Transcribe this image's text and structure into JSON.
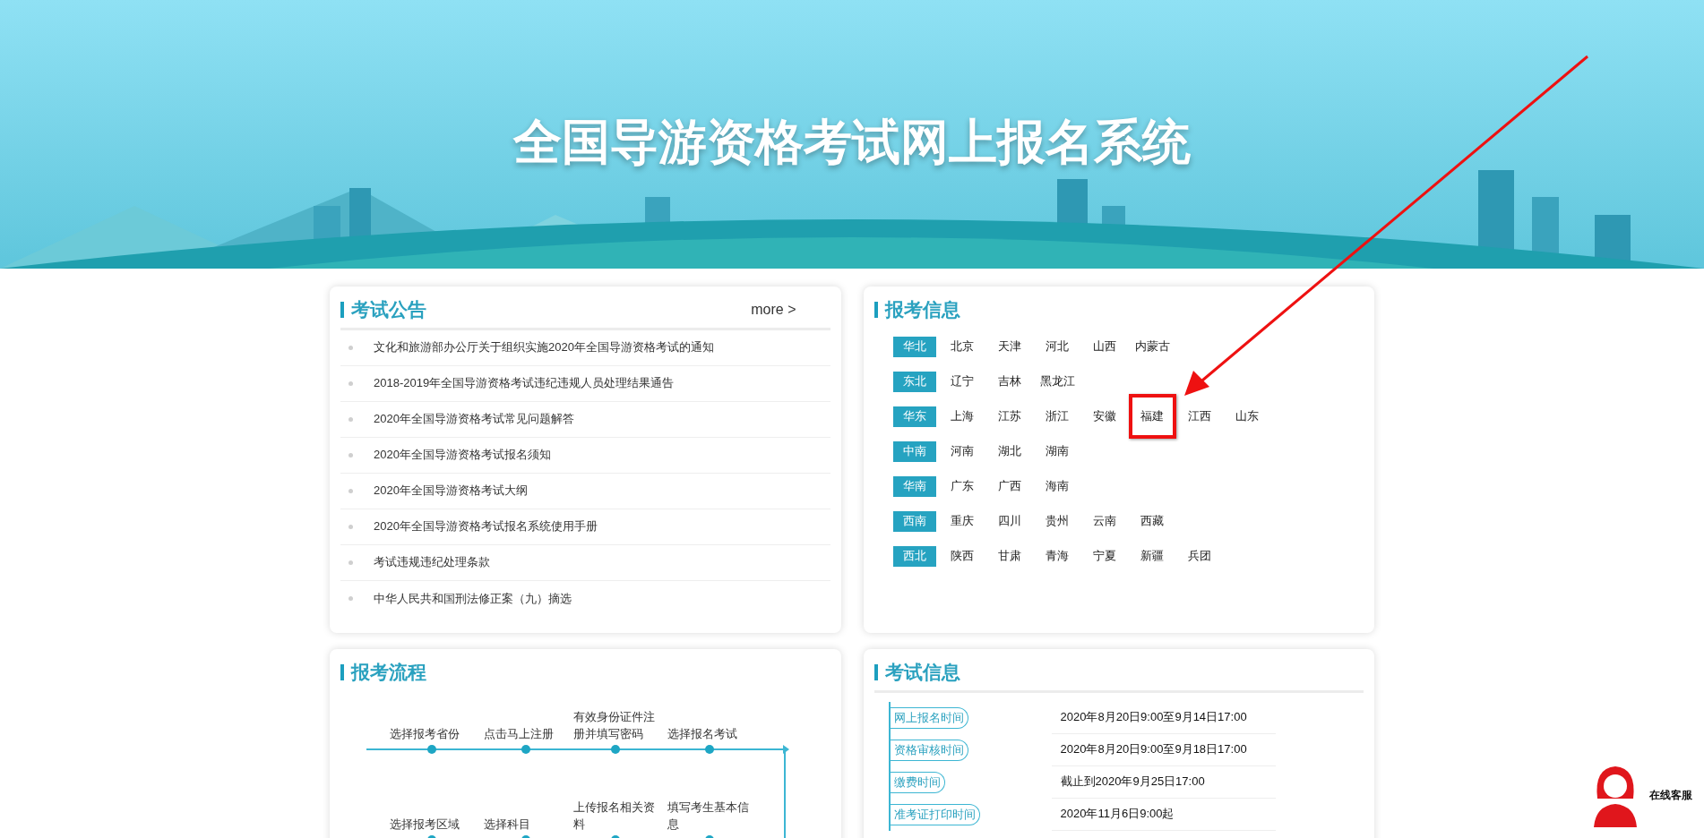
{
  "banner": {
    "title": "全国导游资格考试网上报名系统"
  },
  "announcements": {
    "title": "考试公告",
    "more": "more >",
    "items": [
      "文化和旅游部办公厅关于组织实施2020年全国导游资格考试的通知",
      "2018-2019年全国导游资格考试违纪违规人员处理结果通告",
      "2020年全国导游资格考试常见问题解答",
      "2020年全国导游资格考试报名须知",
      "2020年全国导游资格考试大纲",
      "2020年全国导游资格考试报名系统使用手册",
      "考试违规违纪处理条款",
      "中华人民共和国刑法修正案（九）摘选"
    ]
  },
  "registration_info": {
    "title": "报考信息",
    "regions": [
      {
        "label": "华北",
        "provinces": [
          {
            "name": "北京",
            "highlighted": false
          },
          {
            "name": "天津",
            "highlighted": false
          },
          {
            "name": "河北",
            "highlighted": false
          },
          {
            "name": "山西",
            "highlighted": false
          },
          {
            "name": "内蒙古",
            "highlighted": false
          }
        ]
      },
      {
        "label": "东北",
        "provinces": [
          {
            "name": "辽宁",
            "highlighted": false
          },
          {
            "name": "吉林",
            "highlighted": false
          },
          {
            "name": "黑龙江",
            "highlighted": false
          }
        ]
      },
      {
        "label": "华东",
        "provinces": [
          {
            "name": "上海",
            "highlighted": false
          },
          {
            "name": "江苏",
            "highlighted": false
          },
          {
            "name": "浙江",
            "highlighted": false
          },
          {
            "name": "安徽",
            "highlighted": false
          },
          {
            "name": "福建",
            "highlighted": true
          },
          {
            "name": "江西",
            "highlighted": false
          },
          {
            "name": "山东",
            "highlighted": false
          }
        ]
      },
      {
        "label": "中南",
        "provinces": [
          {
            "name": "河南",
            "highlighted": false
          },
          {
            "name": "湖北",
            "highlighted": false
          },
          {
            "name": "湖南",
            "highlighted": false
          }
        ]
      },
      {
        "label": "华南",
        "provinces": [
          {
            "name": "广东",
            "highlighted": false
          },
          {
            "name": "广西",
            "highlighted": false
          },
          {
            "name": "海南",
            "highlighted": false
          }
        ]
      },
      {
        "label": "西南",
        "provinces": [
          {
            "name": "重庆",
            "highlighted": false
          },
          {
            "name": "四川",
            "highlighted": false
          },
          {
            "name": "贵州",
            "highlighted": false
          },
          {
            "name": "云南",
            "highlighted": false
          },
          {
            "name": "西藏",
            "highlighted": false
          }
        ]
      },
      {
        "label": "西北",
        "provinces": [
          {
            "name": "陕西",
            "highlighted": false
          },
          {
            "name": "甘肃",
            "highlighted": false
          },
          {
            "name": "青海",
            "highlighted": false
          },
          {
            "name": "宁夏",
            "highlighted": false
          },
          {
            "name": "新疆",
            "highlighted": false
          },
          {
            "name": "兵团",
            "highlighted": false
          }
        ]
      }
    ]
  },
  "process": {
    "title": "报考流程",
    "steps_row_1": [
      "选择报考省份",
      "点击马上注册",
      "有效身份证件注册并填写密码",
      "选择报名考试"
    ],
    "steps_row_2": [
      "选择报考区域",
      "选择科目",
      "上传报名相关资料",
      "填写考生基本信息"
    ]
  },
  "exam_info": {
    "title": "考试信息",
    "rows": [
      {
        "label": "网上报名时间",
        "value": "2020年8月20日9:00至9月14日17:00"
      },
      {
        "label": "资格审核时间",
        "value": "2020年8月20日9:00至9月18日17:00"
      },
      {
        "label": "缴费时间",
        "value": "截止到2020年9月25日17:00"
      },
      {
        "label": "准考证打印时间",
        "value": "2020年11月6日9:00起"
      }
    ]
  },
  "customer_service": {
    "label": "在线客服"
  }
}
